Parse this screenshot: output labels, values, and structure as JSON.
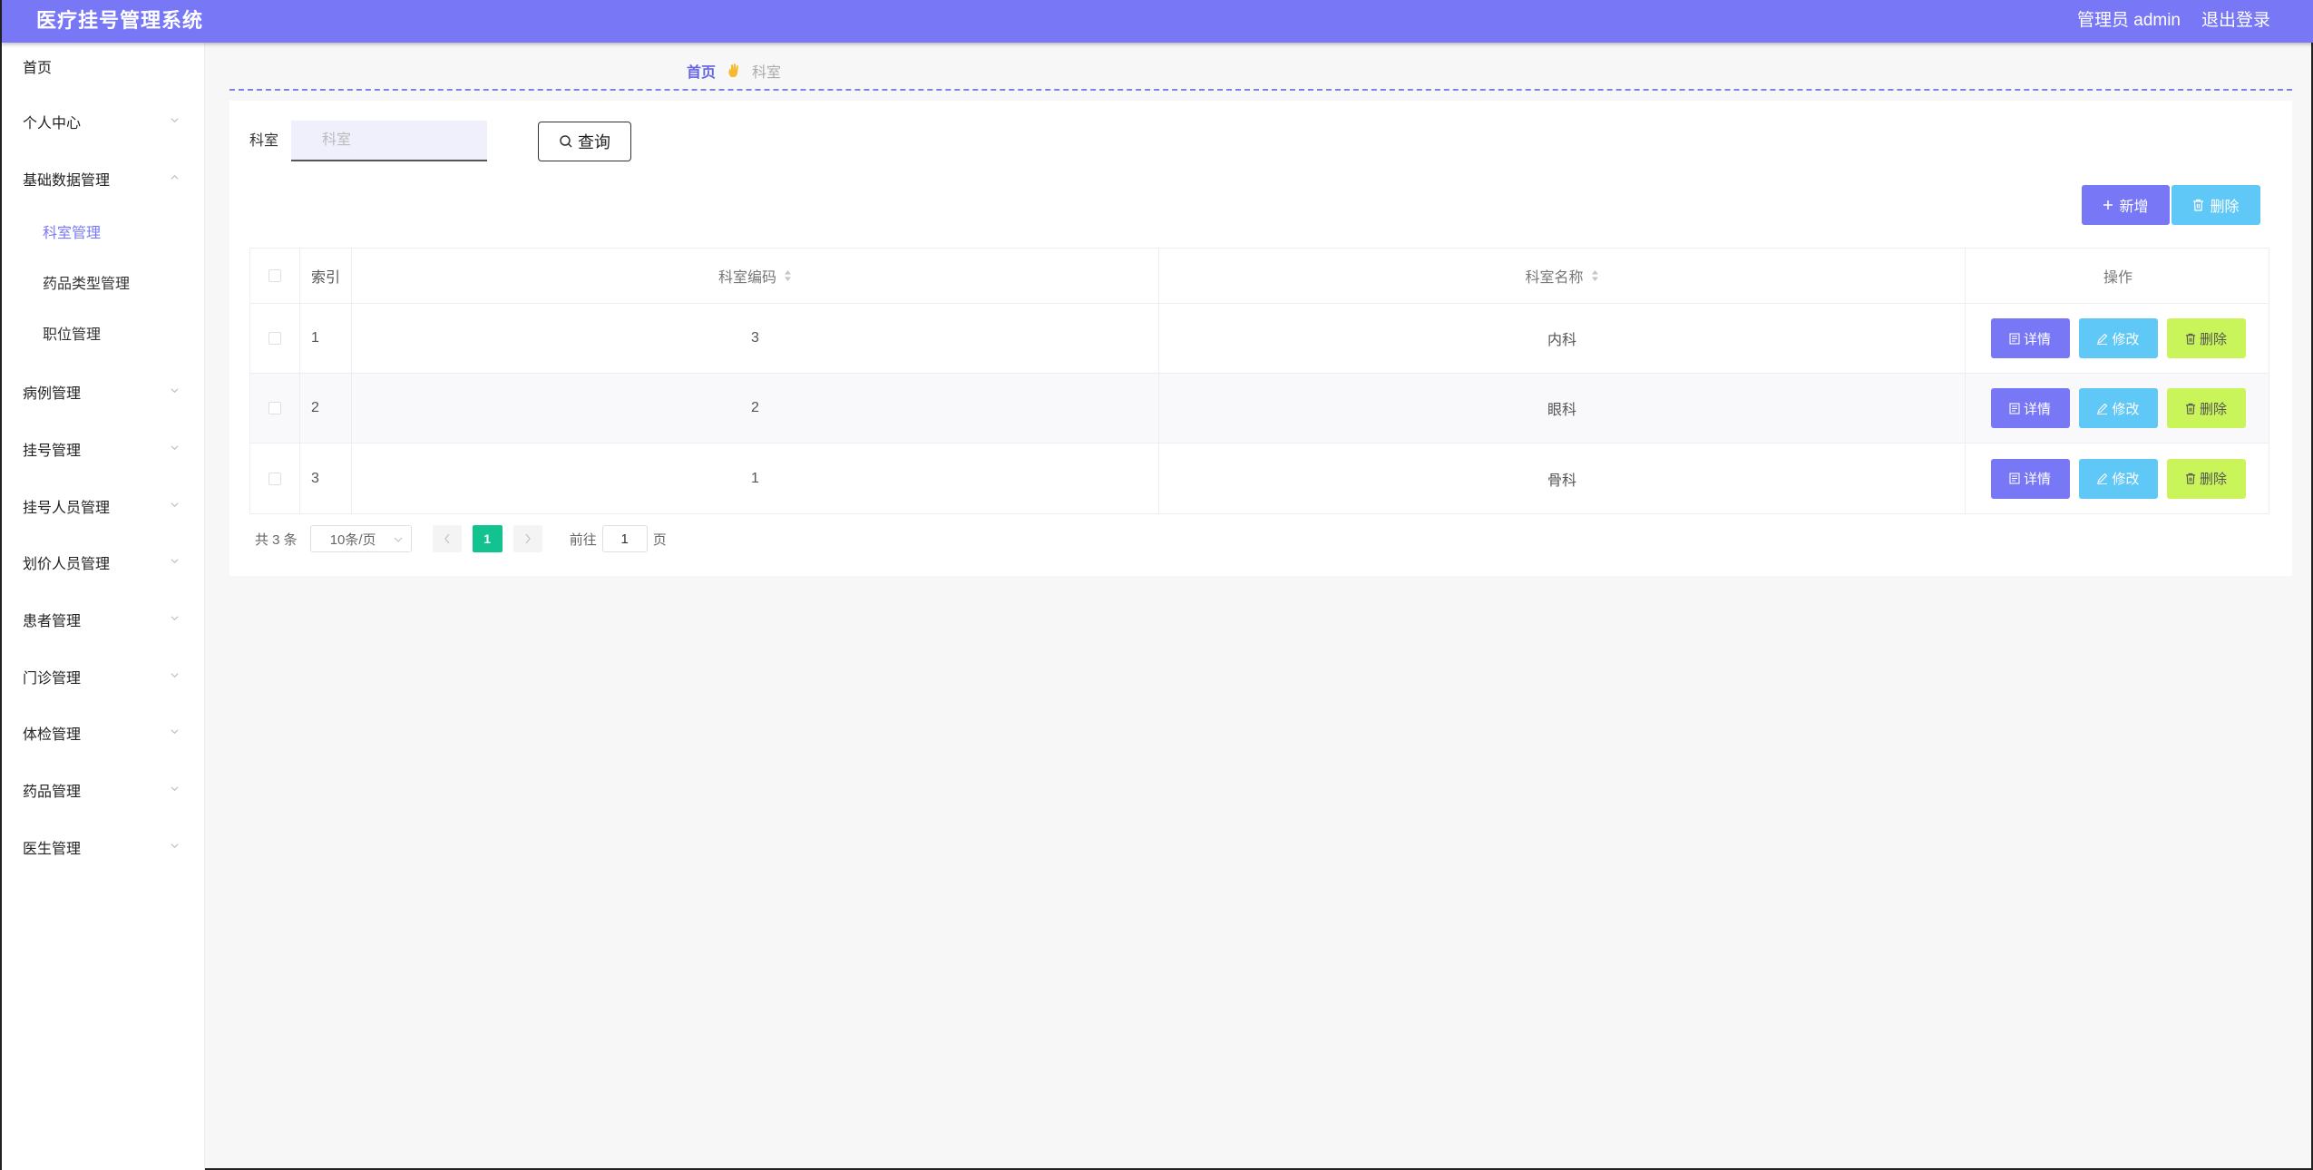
{
  "header": {
    "title": "医疗挂号管理系统",
    "user": "管理员 admin",
    "logout": "退出登录"
  },
  "sidebar": {
    "items": [
      {
        "label": "首页"
      },
      {
        "label": "个人中心"
      },
      {
        "label": "基础数据管理"
      },
      {
        "label": "科室管理"
      },
      {
        "label": "药品类型管理"
      },
      {
        "label": "职位管理"
      },
      {
        "label": "病例管理"
      },
      {
        "label": "挂号管理"
      },
      {
        "label": "挂号人员管理"
      },
      {
        "label": "划价人员管理"
      },
      {
        "label": "患者管理"
      },
      {
        "label": "门诊管理"
      },
      {
        "label": "体检管理"
      },
      {
        "label": "药品管理"
      },
      {
        "label": "医生管理"
      }
    ]
  },
  "breadcrumb": {
    "home": "首页",
    "current": "科室"
  },
  "search": {
    "label": "科室",
    "placeholder": "科室",
    "value": "",
    "button": "查询"
  },
  "actions": {
    "add": "新增",
    "delete": "删除"
  },
  "table": {
    "headers": {
      "index": "索引",
      "code": "科室编码",
      "name": "科室名称",
      "ops": "操作"
    },
    "rows": [
      {
        "index": "1",
        "code": "3",
        "name": "内科"
      },
      {
        "index": "2",
        "code": "2",
        "name": "眼科"
      },
      {
        "index": "3",
        "code": "1",
        "name": "骨科"
      }
    ],
    "row_actions": {
      "detail": "详情",
      "edit": "修改",
      "delete": "删除"
    }
  },
  "pagination": {
    "total": "共 3 条",
    "page_size": "10条/页",
    "current_page": "1",
    "goto_label": "前往",
    "goto_value": "1",
    "page_suffix": "页"
  },
  "colors": {
    "primary": "#7878f6",
    "info": "#60c8f6",
    "danger_lime": "#c9f55a",
    "pager_active": "#13c38f"
  }
}
